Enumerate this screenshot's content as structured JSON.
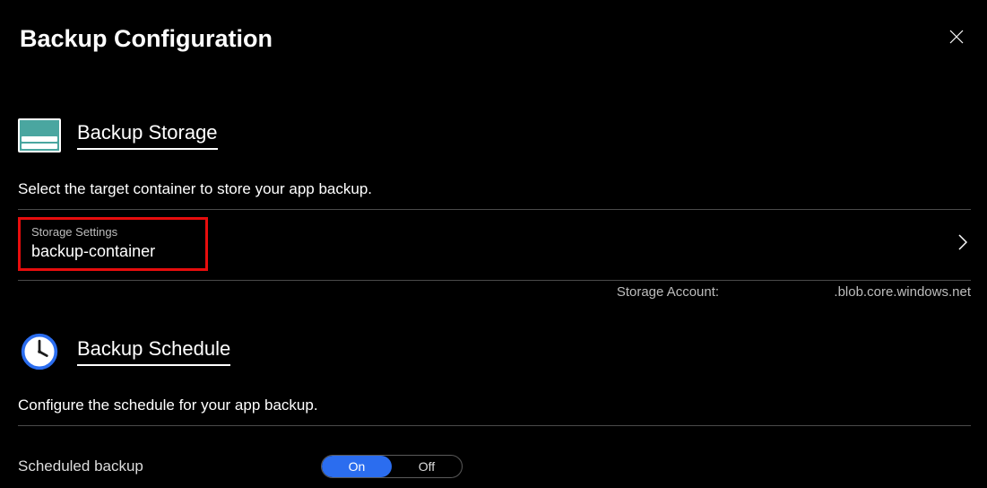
{
  "header": {
    "title": "Backup Configuration"
  },
  "storage": {
    "section_title": "Backup Storage",
    "description": "Select the target container to store your app backup.",
    "settings_label": "Storage Settings",
    "settings_value": "backup-container",
    "account_label": "Storage Account: ",
    "account_suffix": ".blob.core.windows.net"
  },
  "schedule": {
    "section_title": "Backup Schedule",
    "description": "Configure the schedule for your app backup.",
    "toggle_label": "Scheduled backup",
    "option_on": "On",
    "option_off": "Off",
    "active": "On"
  }
}
